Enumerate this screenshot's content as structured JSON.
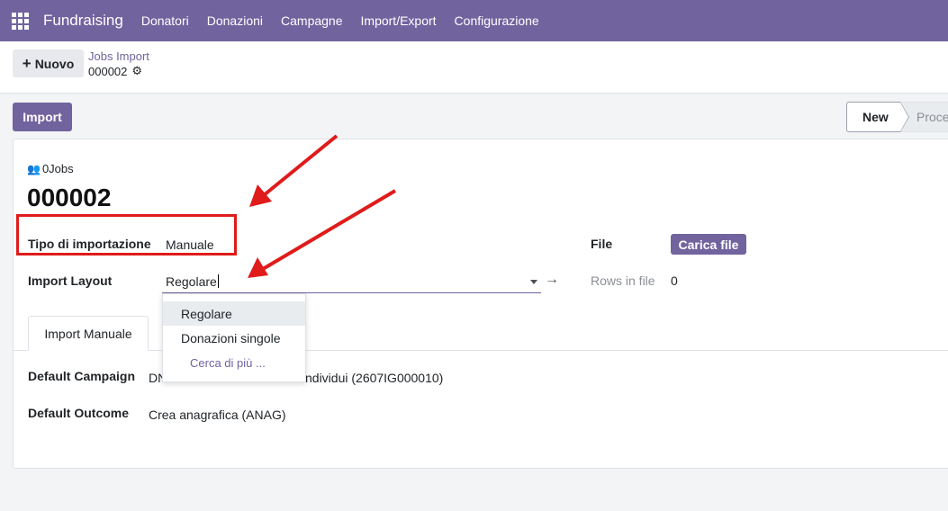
{
  "navbar": {
    "brand": "Fundraising",
    "menu": [
      "Donatori",
      "Donazioni",
      "Campagne",
      "Import/Export",
      "Configurazione"
    ]
  },
  "control_panel": {
    "new_button": "Nuovo",
    "breadcrumb_parent": "Jobs Import",
    "breadcrumb_current": "000002"
  },
  "actions": {
    "import_button": "Import"
  },
  "statusbar": {
    "stages": [
      "New",
      "Proce"
    ],
    "active": "New"
  },
  "form": {
    "smart_button": "0Jobs",
    "record_name": "000002",
    "tipo_label": "Tipo di importazione",
    "tipo_value": "Manuale",
    "layout_label": "Import Layout",
    "layout_value": "Regolare",
    "file_label": "File",
    "file_button": "Carica file",
    "rows_label": "Rows in file",
    "rows_value": "0",
    "tab_label": "Import Manuale",
    "campaign_label": "Default Campaign",
    "campaign_value_start": "DN",
    "campaign_value_end": "ndividui (2607IG000010)",
    "outcome_label": "Default Outcome",
    "outcome_value": "Crea anagrafica (ANAG)"
  },
  "dropdown": {
    "options": [
      "Regolare",
      "Donazioni singole"
    ],
    "search_more": "Cerca di più ..."
  },
  "colors": {
    "brand": "#71639e",
    "annotation": "#e01b1b"
  }
}
